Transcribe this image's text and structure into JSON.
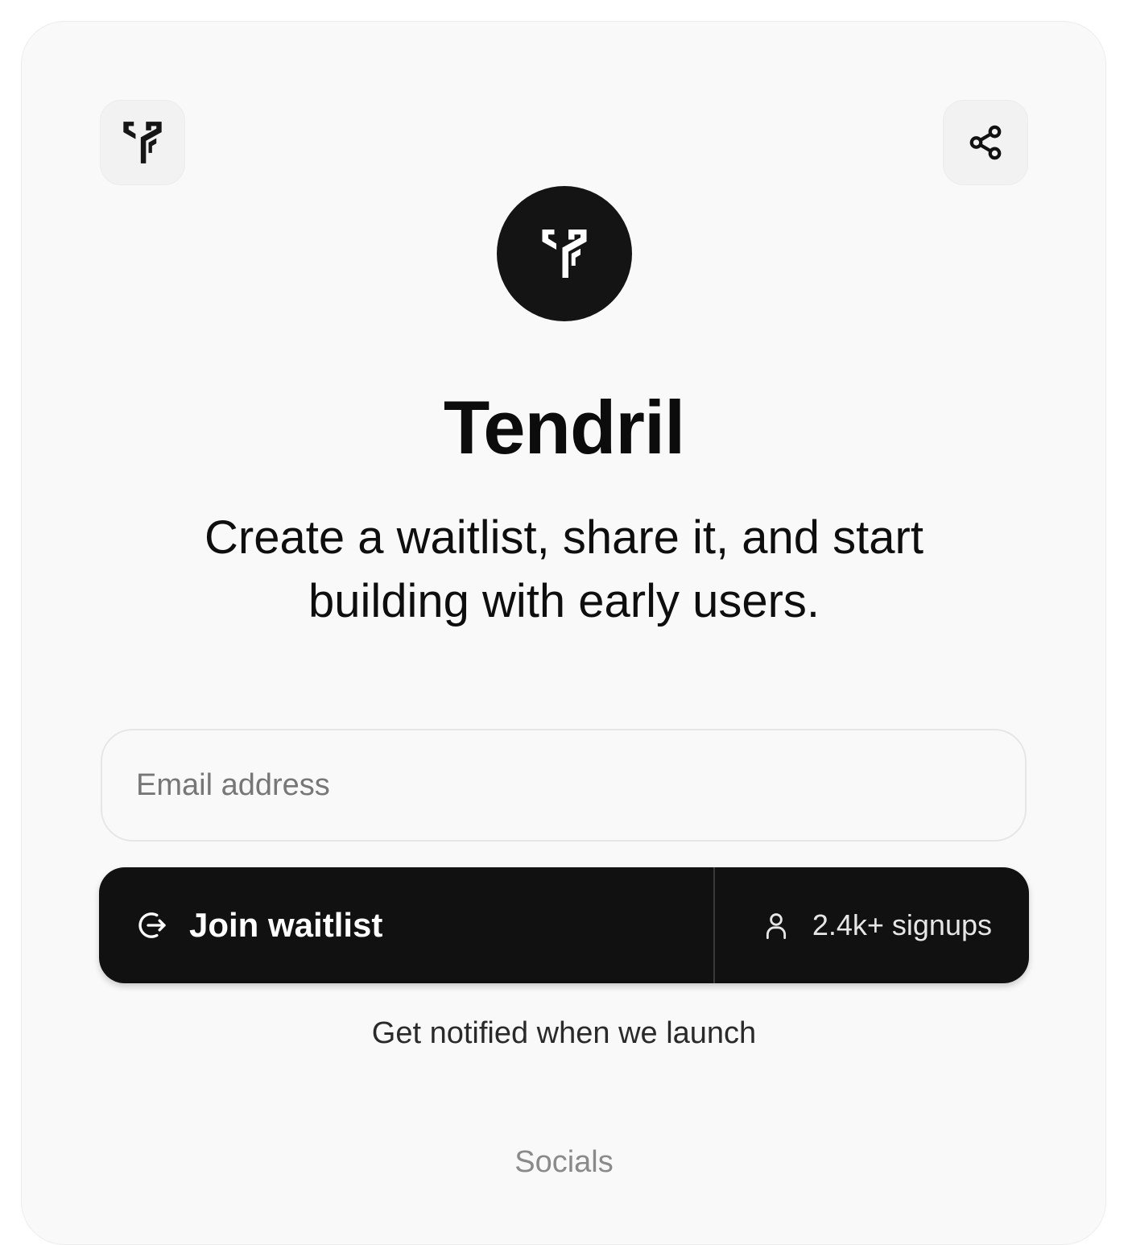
{
  "brand": {
    "name": "Tendril",
    "tagline": "Create a waitlist, share it, and start building with early users."
  },
  "form": {
    "email_placeholder": "Email address",
    "join_label": "Join waitlist",
    "signups_label": "2.4k+ signups",
    "notify_text": "Get notified when we launch"
  },
  "footer": {
    "socials_label": "Socials"
  },
  "icons": {
    "logo": "tendril-logo-icon",
    "share": "share-icon",
    "join": "sign-in-arrow-icon",
    "user": "user-icon"
  },
  "colors": {
    "background": "#f9f9f9",
    "primary": "#111111",
    "text": "#0c0c0c",
    "muted": "#8a8a8a"
  }
}
